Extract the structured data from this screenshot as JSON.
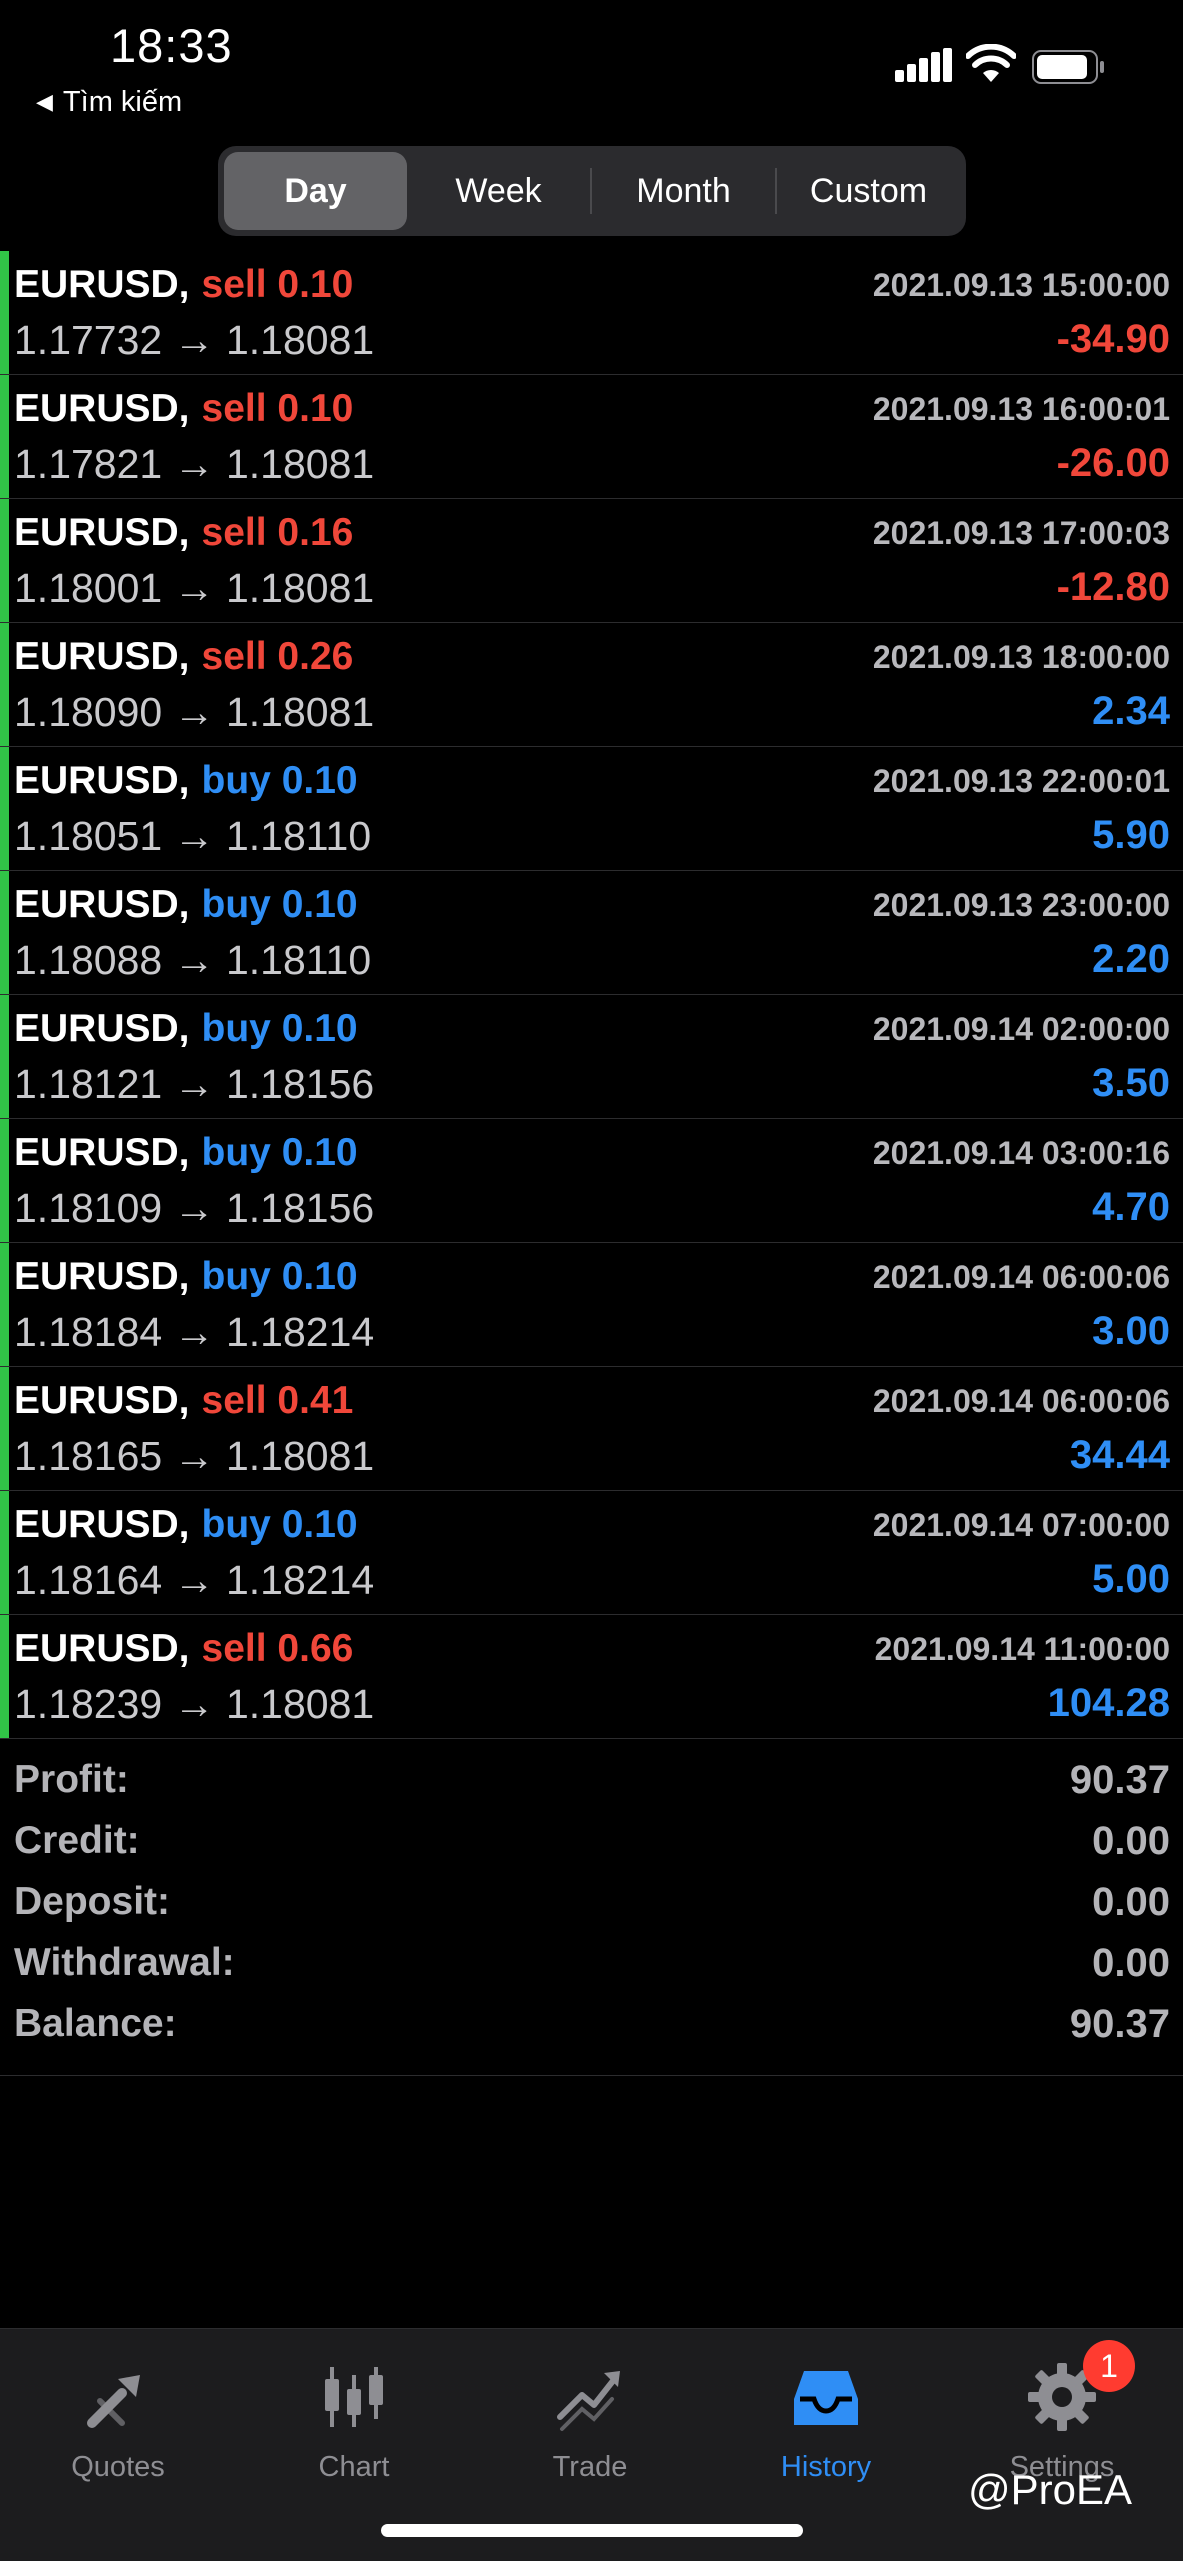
{
  "status_bar": {
    "time": "18:33",
    "back_label": "Tìm kiếm"
  },
  "period_tabs": [
    {
      "label": "Day",
      "active": true
    },
    {
      "label": "Week",
      "active": false
    },
    {
      "label": "Month",
      "active": false
    },
    {
      "label": "Custom",
      "active": false
    }
  ],
  "colors": {
    "sell": "#f0473a",
    "buy": "#2f8ef5",
    "accent": "#2f8ef5",
    "row_marker": "#31c447"
  },
  "trades": [
    {
      "symbol": "EURUSD,",
      "side": "sell 0.10",
      "type": "sell",
      "datetime": "2021.09.13 15:00:00",
      "prices": "1.17732 → 1.18081",
      "profit": "-34.90",
      "profit_color": "red"
    },
    {
      "symbol": "EURUSD,",
      "side": "sell 0.10",
      "type": "sell",
      "datetime": "2021.09.13 16:00:01",
      "prices": "1.17821 → 1.18081",
      "profit": "-26.00",
      "profit_color": "red"
    },
    {
      "symbol": "EURUSD,",
      "side": "sell 0.16",
      "type": "sell",
      "datetime": "2021.09.13 17:00:03",
      "prices": "1.18001 → 1.18081",
      "profit": "-12.80",
      "profit_color": "red"
    },
    {
      "symbol": "EURUSD,",
      "side": "sell 0.26",
      "type": "sell",
      "datetime": "2021.09.13 18:00:00",
      "prices": "1.18090 → 1.18081",
      "profit": "2.34",
      "profit_color": "blue"
    },
    {
      "symbol": "EURUSD,",
      "side": "buy 0.10",
      "type": "buy",
      "datetime": "2021.09.13 22:00:01",
      "prices": "1.18051 → 1.18110",
      "profit": "5.90",
      "profit_color": "blue"
    },
    {
      "symbol": "EURUSD,",
      "side": "buy 0.10",
      "type": "buy",
      "datetime": "2021.09.13 23:00:00",
      "prices": "1.18088 → 1.18110",
      "profit": "2.20",
      "profit_color": "blue"
    },
    {
      "symbol": "EURUSD,",
      "side": "buy 0.10",
      "type": "buy",
      "datetime": "2021.09.14 02:00:00",
      "prices": "1.18121 → 1.18156",
      "profit": "3.50",
      "profit_color": "blue"
    },
    {
      "symbol": "EURUSD,",
      "side": "buy 0.10",
      "type": "buy",
      "datetime": "2021.09.14 03:00:16",
      "prices": "1.18109 → 1.18156",
      "profit": "4.70",
      "profit_color": "blue"
    },
    {
      "symbol": "EURUSD,",
      "side": "buy 0.10",
      "type": "buy",
      "datetime": "2021.09.14 06:00:06",
      "prices": "1.18184 → 1.18214",
      "profit": "3.00",
      "profit_color": "blue"
    },
    {
      "symbol": "EURUSD,",
      "side": "sell 0.41",
      "type": "sell",
      "datetime": "2021.09.14 06:00:06",
      "prices": "1.18165 → 1.18081",
      "profit": "34.44",
      "profit_color": "blue"
    },
    {
      "symbol": "EURUSD,",
      "side": "buy 0.10",
      "type": "buy",
      "datetime": "2021.09.14 07:00:00",
      "prices": "1.18164 → 1.18214",
      "profit": "5.00",
      "profit_color": "blue"
    },
    {
      "symbol": "EURUSD,",
      "side": "sell 0.66",
      "type": "sell",
      "datetime": "2021.09.14 11:00:00",
      "prices": "1.18239 → 1.18081",
      "profit": "104.28",
      "profit_color": "blue"
    }
  ],
  "summary": [
    {
      "label": "Profit:",
      "value": "90.37"
    },
    {
      "label": "Credit:",
      "value": "0.00"
    },
    {
      "label": "Deposit:",
      "value": "0.00"
    },
    {
      "label": "Withdrawal:",
      "value": "0.00"
    },
    {
      "label": "Balance:",
      "value": "90.37"
    }
  ],
  "tab_bar": [
    {
      "label": "Quotes",
      "icon": "quotes-icon",
      "active": false
    },
    {
      "label": "Chart",
      "icon": "chart-icon",
      "active": false
    },
    {
      "label": "Trade",
      "icon": "trade-icon",
      "active": false
    },
    {
      "label": "History",
      "icon": "history-icon",
      "active": true
    },
    {
      "label": "Settings",
      "icon": "gear-icon",
      "active": false
    }
  ],
  "settings_badge": "1",
  "watermark": "@ProEA"
}
